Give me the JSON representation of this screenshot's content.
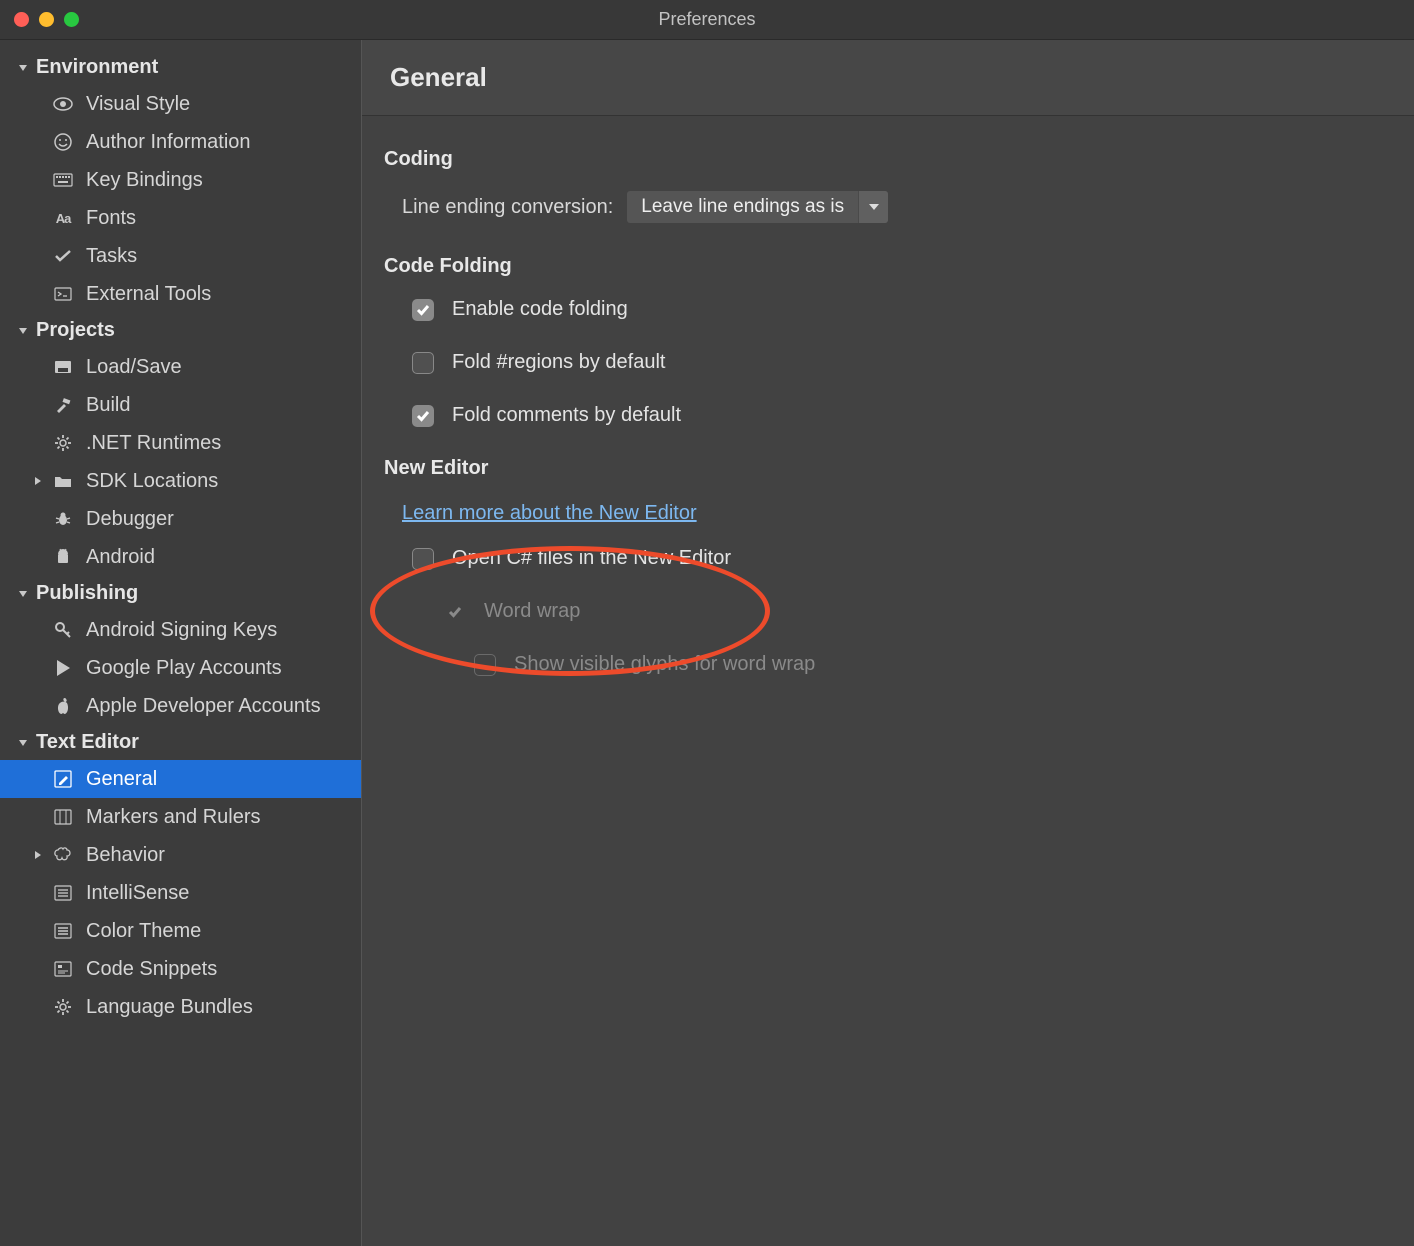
{
  "window": {
    "title": "Preferences"
  },
  "sidebar": {
    "sections": [
      {
        "name": "environment",
        "label": "Environment",
        "expanded": true,
        "items": [
          {
            "name": "visual-style",
            "label": "Visual Style",
            "icon": "eye-icon"
          },
          {
            "name": "author-information",
            "label": "Author Information",
            "icon": "smile-icon"
          },
          {
            "name": "key-bindings",
            "label": "Key Bindings",
            "icon": "keyboard-icon"
          },
          {
            "name": "fonts",
            "label": "Fonts",
            "icon": "font-icon"
          },
          {
            "name": "tasks",
            "label": "Tasks",
            "icon": "check-icon"
          },
          {
            "name": "external-tools",
            "label": "External Tools",
            "icon": "terminal-icon"
          }
        ]
      },
      {
        "name": "projects",
        "label": "Projects",
        "expanded": true,
        "items": [
          {
            "name": "load-save",
            "label": "Load/Save",
            "icon": "disk-icon"
          },
          {
            "name": "build",
            "label": "Build",
            "icon": "hammer-icon"
          },
          {
            "name": "net-runtimes",
            "label": ".NET Runtimes",
            "icon": "gear-icon"
          },
          {
            "name": "sdk-locations",
            "label": "SDK Locations",
            "icon": "folder-icon",
            "has_children": true
          },
          {
            "name": "debugger",
            "label": "Debugger",
            "icon": "bug-icon"
          },
          {
            "name": "android",
            "label": "Android",
            "icon": "android-icon"
          }
        ]
      },
      {
        "name": "publishing",
        "label": "Publishing",
        "expanded": true,
        "items": [
          {
            "name": "android-signing-keys",
            "label": "Android Signing Keys",
            "icon": "key-icon"
          },
          {
            "name": "google-play-accounts",
            "label": "Google Play Accounts",
            "icon": "play-icon"
          },
          {
            "name": "apple-developer-accounts",
            "label": "Apple Developer Accounts",
            "icon": "apple-icon"
          }
        ]
      },
      {
        "name": "text-editor",
        "label": "Text Editor",
        "expanded": true,
        "items": [
          {
            "name": "general",
            "label": "General",
            "icon": "edit-icon",
            "selected": true
          },
          {
            "name": "markers-and-rulers",
            "label": "Markers and Rulers",
            "icon": "ruler-icon"
          },
          {
            "name": "behavior",
            "label": "Behavior",
            "icon": "brain-icon",
            "has_children": true
          },
          {
            "name": "intellisense",
            "label": "IntelliSense",
            "icon": "list-icon"
          },
          {
            "name": "color-theme",
            "label": "Color Theme",
            "icon": "palette-icon"
          },
          {
            "name": "code-snippets",
            "label": "Code Snippets",
            "icon": "snippet-icon"
          },
          {
            "name": "language-bundles",
            "label": "Language Bundles",
            "icon": "gear-icon"
          }
        ]
      }
    ]
  },
  "main": {
    "heading": "General",
    "coding": {
      "title": "Coding",
      "line_ending_label": "Line ending conversion:",
      "line_ending_value": "Leave line endings as is"
    },
    "code_folding": {
      "title": "Code Folding",
      "enable_label": "Enable code folding",
      "enable_checked": true,
      "regions_label": "Fold #regions by default",
      "regions_checked": false,
      "comments_label": "Fold comments by default",
      "comments_checked": true
    },
    "new_editor": {
      "title": "New Editor",
      "learn_more": "Learn more about the New Editor",
      "open_csharp_label": "Open C# files in the New Editor",
      "open_csharp_checked": false,
      "word_wrap_label": "Word wrap",
      "word_wrap_checked": true,
      "glyphs_label": "Show visible glyphs for word wrap",
      "glyphs_checked": false
    }
  }
}
